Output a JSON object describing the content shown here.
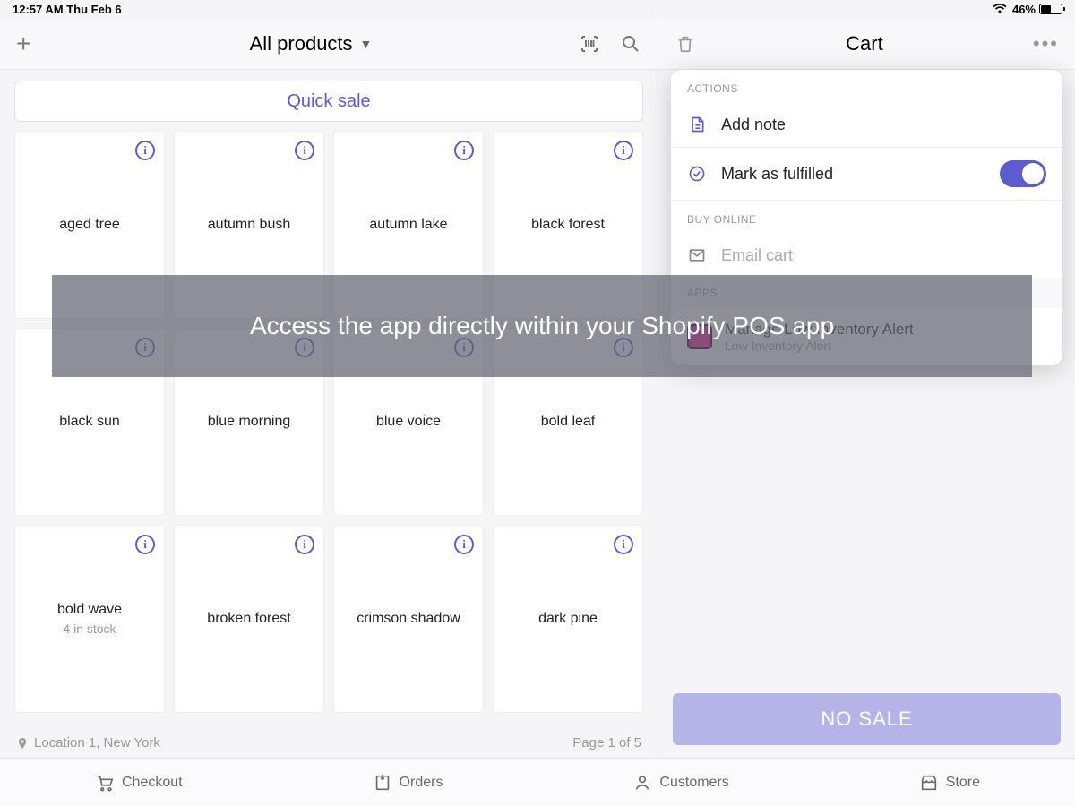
{
  "status": {
    "time_date": "12:57 AM   Thu Feb 6",
    "battery_pct": "46%"
  },
  "left": {
    "title": "All products",
    "quick_sale": "Quick sale",
    "products": [
      {
        "name": "aged tree"
      },
      {
        "name": "autumn bush"
      },
      {
        "name": "autumn lake"
      },
      {
        "name": "black forest"
      },
      {
        "name": "black sun"
      },
      {
        "name": "blue morning"
      },
      {
        "name": "blue voice"
      },
      {
        "name": "bold leaf"
      },
      {
        "name": "bold wave",
        "sub": "4 in stock"
      },
      {
        "name": "broken forest"
      },
      {
        "name": "crimson shadow"
      },
      {
        "name": "dark pine"
      }
    ],
    "location": "Location 1, New York",
    "page_info": "Page 1 of 5"
  },
  "cart": {
    "title": "Cart",
    "dropdown": {
      "actions_label": "ACTIONS",
      "add_note": "Add note",
      "mark_fulfilled": "Mark as fulfilled",
      "buy_online_label": "BUY ONLINE",
      "email_cart": "Email cart",
      "apps_label": "APPS",
      "app_title": "Manage Low Inventory Alert",
      "app_sub": "Low Inventory Alert"
    },
    "no_sale": "NO SALE"
  },
  "banner": "Access the app directly within your Shopify POS app",
  "nav": {
    "checkout": "Checkout",
    "orders": "Orders",
    "customers": "Customers",
    "store": "Store"
  }
}
